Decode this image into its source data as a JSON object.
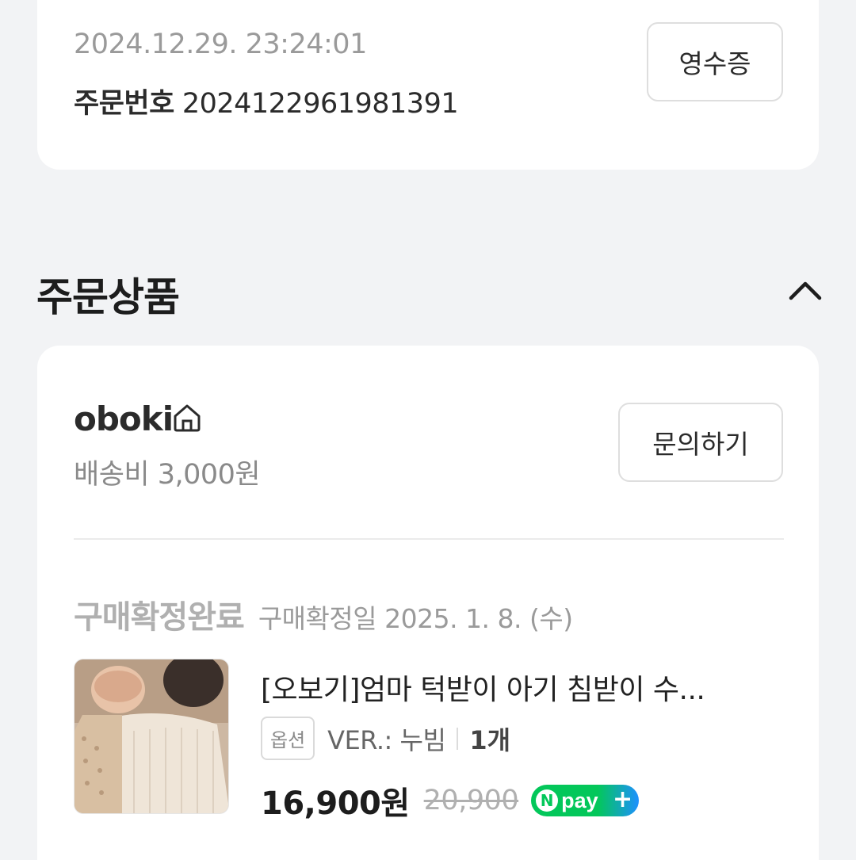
{
  "order": {
    "datetime": "2024.12.29. 23:24:01",
    "number_label": "주문번호",
    "number": "2024122961981391",
    "receipt_button": "영수증"
  },
  "section": {
    "title": "주문상품",
    "toggle_icon": "chevron-up-icon"
  },
  "store": {
    "name": "oboki",
    "icon": "home-icon",
    "shipping": "배송비 3,000원",
    "inquiry_button": "문의하기"
  },
  "item": {
    "status": "구매확정완료",
    "confirm_date": "구매확정일 2025. 1. 8. (수)",
    "name": "[오보기]엄마 턱받이 아기 침받이 수...",
    "option_badge": "옵션",
    "option_value": "VER.: 누빔",
    "quantity": "1개",
    "price": "16,900원",
    "original_price": "20,900",
    "pay_badge": {
      "n": "N",
      "text": "pay",
      "plus": "+",
      "colors": {
        "green": "#03c75a",
        "blue": "#1e90ff"
      }
    }
  }
}
